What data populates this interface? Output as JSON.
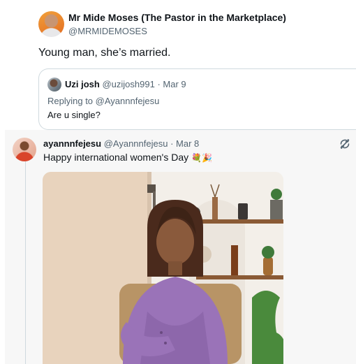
{
  "main_tweet": {
    "author_name": "Mr Mide Moses (The Pastor in the Marketplace)",
    "author_handle": "@MRMIDEMOSES",
    "text": "Young man, she’s married."
  },
  "quoted_tweet": {
    "author_name": "Uzi josh",
    "author_handle": "@uzijosh991",
    "date": "· Mar 9",
    "replying_to": "Replying to @Ayannnfejesu",
    "text": "Are u single?"
  },
  "thread_tweet": {
    "author_name": "ayannnfejesu",
    "author_handle": "@Ayannnfejesu",
    "date": "· Mar 8",
    "text": "Happy international women's Day",
    "emoji": "💐🎉",
    "photo_description_icon": "woman-in-purple-dress-photo",
    "retweet_icon": "refresh-icon"
  },
  "colors": {
    "secondary_text": "#536471",
    "border": "#cfd9de",
    "dress_purple": "#9a73b8"
  }
}
